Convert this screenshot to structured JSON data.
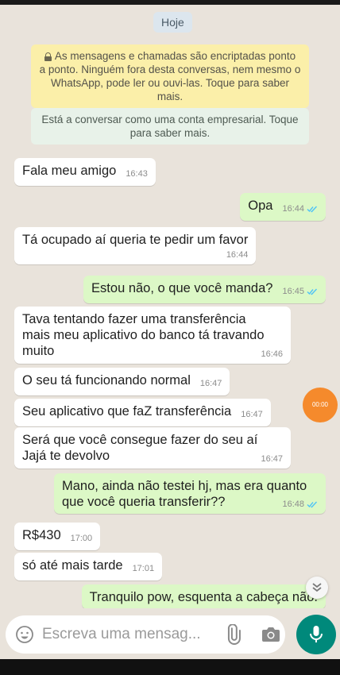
{
  "date_label": "Hoje",
  "encryption_notice": "As mensagens e chamadas são encriptadas ponto\na ponto. Ninguém fora desta conversas, nem mesmo o\nWhatsApp, pode ler ou ouvi-las. Toque para saber mais.",
  "business_notice": "Está a conversar como uma conta empresarial. Toque\npara saber mais.",
  "messages": [
    {
      "dir": "in",
      "text": "Fala meu amigo",
      "time": "16:43"
    },
    {
      "dir": "out",
      "text": "Opa",
      "time": "16:44"
    },
    {
      "dir": "in",
      "text": "Tá ocupado aí queria te pedir um favor",
      "time": "16:44"
    },
    {
      "dir": "out",
      "text": "Estou não, o que você manda?",
      "time": "16:45"
    },
    {
      "dir": "in",
      "text": "Tava tentando fazer uma transferência\nmais meu aplicativo do banco tá travando\nmuito",
      "time": "16:46"
    },
    {
      "dir": "in",
      "text": "O seu tá funcionando normal",
      "time": "16:47"
    },
    {
      "dir": "in",
      "text": "Seu aplicativo que faZ transferência",
      "time": "16:47"
    },
    {
      "dir": "in",
      "text": "Será que você consegue fazer do seu aí\nJajá te devolvo",
      "time": "16:47"
    },
    {
      "dir": "out",
      "text": "Mano, ainda não testei hj, mas era quanto\nque você queria transferir??",
      "time": "16:48"
    },
    {
      "dir": "in",
      "text": "R$430",
      "time": "17:00"
    },
    {
      "dir": "in",
      "text": "só até mais tarde",
      "time": "17:01"
    },
    {
      "dir": "out",
      "text": "Tranquilo pow, esquenta a cabeça não.",
      "time": ""
    }
  ],
  "floating_timer": "00:00",
  "input": {
    "placeholder": "Escreva uma mensag..."
  },
  "icons": {
    "emoji": "emoji-icon",
    "attach": "paperclip-icon",
    "camera": "camera-icon",
    "mic": "microphone-icon",
    "scroll": "chevron-down-double-icon",
    "read": "double-check-icon"
  },
  "colors": {
    "chat_bg": "#e9e3db",
    "outgoing": "#dcf8c6",
    "incoming": "#ffffff",
    "encryption_bg": "#fbefa9",
    "business_bg": "#e8f2e9",
    "accent": "#00897b",
    "read_ticks": "#4fc3f7"
  }
}
